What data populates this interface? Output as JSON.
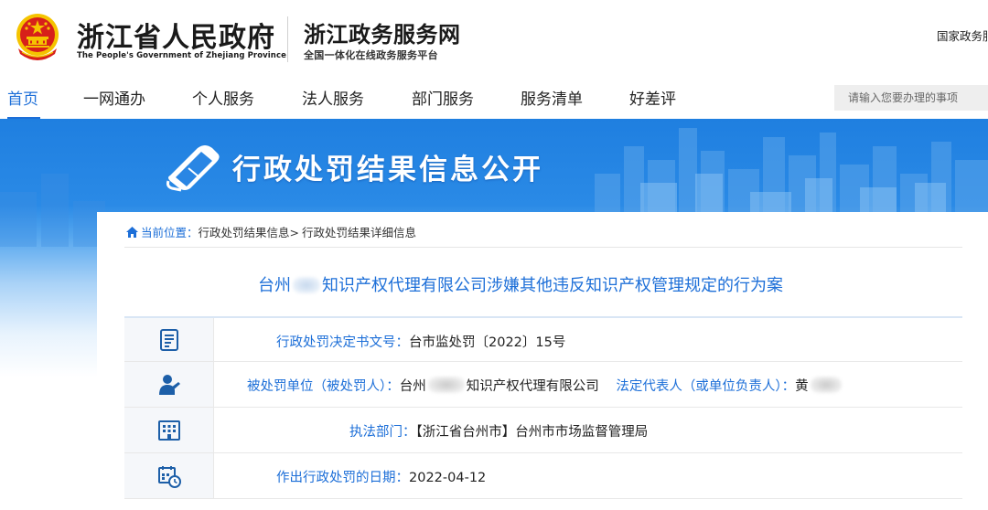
{
  "header": {
    "gov_name": "浙江省人民政府",
    "gov_name_en": "The People's Government of Zhejiang Province",
    "service_name": "浙江政务服务网",
    "service_sub": "全国一体化在线政务服务平台",
    "top_right_link": "国家政务服"
  },
  "nav": {
    "items": [
      {
        "label": "首页",
        "active": true
      },
      {
        "label": "一网通办"
      },
      {
        "label": "个人服务"
      },
      {
        "label": "法人服务"
      },
      {
        "label": "部门服务"
      },
      {
        "label": "服务清单"
      },
      {
        "label": "好差评"
      }
    ],
    "search_placeholder": "请输入您要办理的事项"
  },
  "banner": {
    "title": "行政处罚结果信息公开"
  },
  "breadcrumb": {
    "label": "当前位置：",
    "items": [
      "行政处罚结果信息>",
      "行政处罚结果详细信息"
    ]
  },
  "case": {
    "title_prefix": "台州",
    "title_suffix": "知识产权代理有限公司涉嫌其他违反知识产权管理规定的行为案"
  },
  "rows": [
    {
      "icon": "document-list-icon",
      "label": "行政处罚决定书文号：",
      "value": "台市监处罚〔2022〕15号"
    },
    {
      "icon": "person-icon",
      "label": "被处罚单位（被处罚人）：",
      "value_prefix": "台州",
      "value_suffix": "知识产权代理有限公司",
      "label2": "法定代表人（或单位负责人）：",
      "value2_prefix": "黄"
    },
    {
      "icon": "building-icon",
      "label": "执法部门：",
      "value": "【浙江省台州市】台州市市场监督管理局"
    },
    {
      "icon": "calendar-clock-icon",
      "label": "作出行政处罚的日期：",
      "value": "2022-04-12"
    }
  ],
  "colors": {
    "accent": "#1d6fd8",
    "banner_blue": "#1f7fe0",
    "emblem_red": "#d7201a",
    "emblem_gold": "#f5c400"
  }
}
